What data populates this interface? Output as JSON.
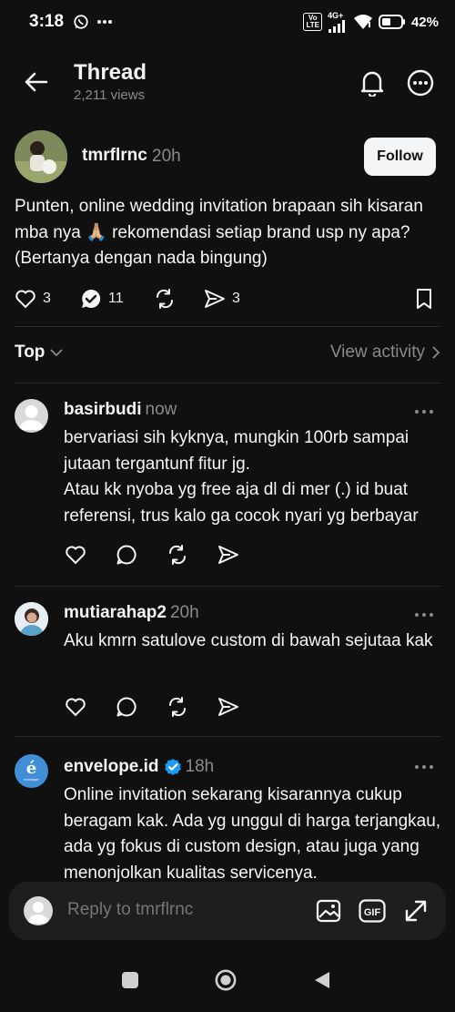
{
  "status_bar": {
    "time": "3:18",
    "battery": "42%",
    "network": "4G+",
    "volte": "Vo LTE"
  },
  "header": {
    "title": "Thread",
    "views": "2,211 views"
  },
  "post": {
    "username": "tmrflrnc",
    "time": "20h",
    "follow_label": "Follow",
    "text": "Punten, online wedding invitation brapaan sih kisaran mba nya 🙏🏼 rekomendasi setiap brand usp ny apa? (Bertanya dengan nada bingung)",
    "likes": "3",
    "reposts_count": "11",
    "shares": "3"
  },
  "sort": {
    "label": "Top",
    "view_activity": "View activity"
  },
  "replies": [
    {
      "username": "basirbudi",
      "time": "now",
      "text": "bervariasi sih kyknya, mungkin 100rb sampai jutaan tergantunf fitur jg.\nAtau kk nyoba yg free aja dl di mer (.) id buat referensi, trus kalo ga cocok nyari yg berbayar"
    },
    {
      "username": "mutiarahap2",
      "time": "20h",
      "text": "Aku kmrn satulove custom di bawah sejutaa kak"
    },
    {
      "username": "envelope.id",
      "time": "18h",
      "verified": true,
      "text": "Online invitation sekarang kisarannya cukup beragam kak. Ada yg unggul di harga terjangkau, ada yg fokus di custom design, atau juga yang menonjolkan kualitas servicenya.",
      "avatar_letter": "é",
      "avatar_caption": "envelope"
    }
  ],
  "composer": {
    "placeholder": "Reply to tmrflrnc"
  },
  "colors": {
    "background": "#101010",
    "text": "#f3f5f7",
    "muted": "#8a8a8a",
    "verified": "#1d9bf0"
  }
}
